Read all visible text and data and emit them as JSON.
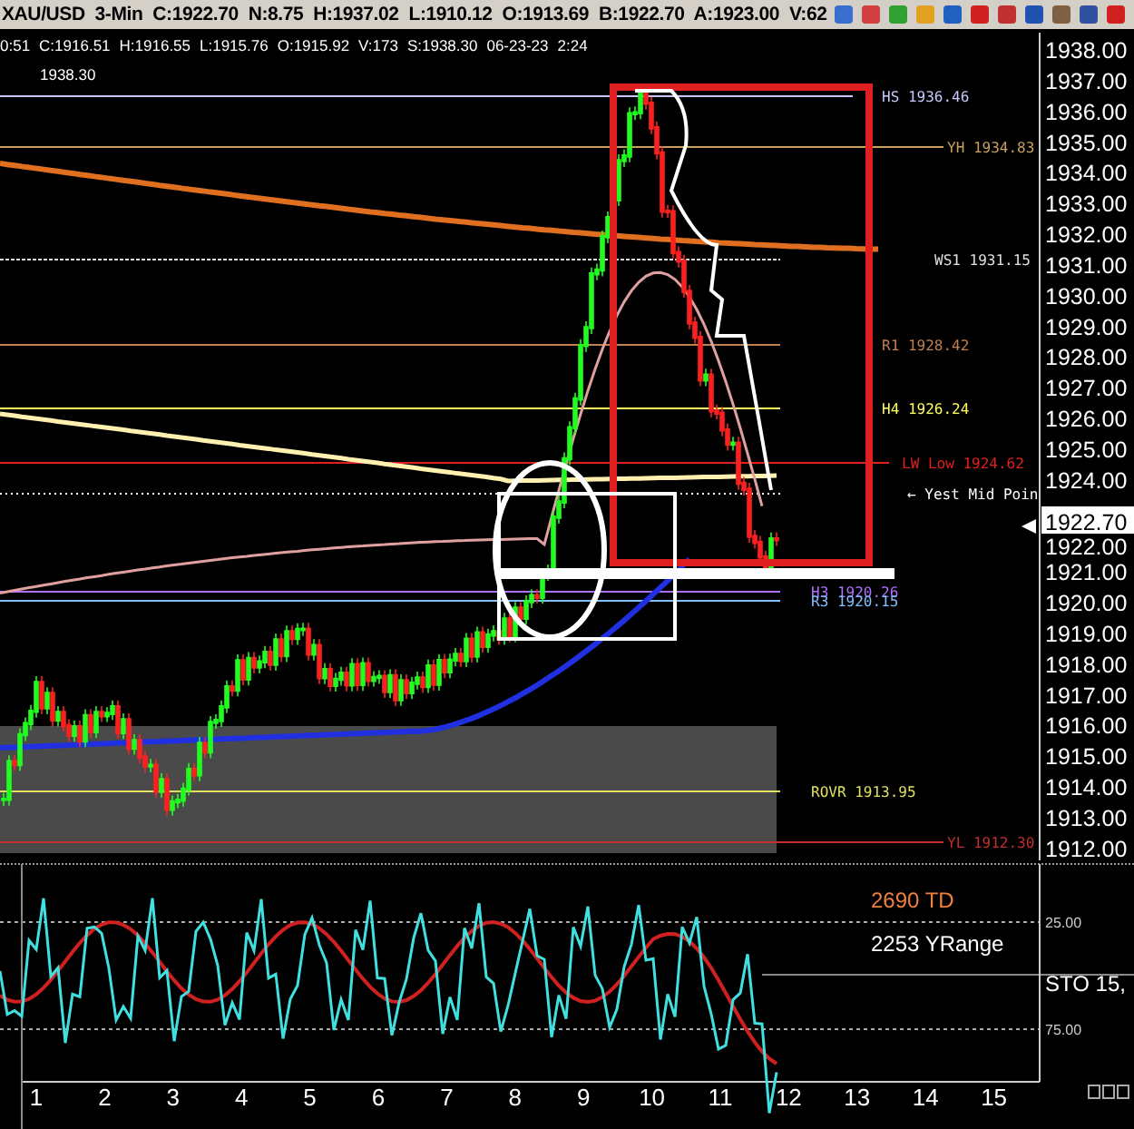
{
  "title_bar": {
    "symbol": "XAU/USD",
    "interval": "3-Min",
    "quote": [
      "C:1922.70",
      "N:8.75",
      "H:1937.02",
      "L:1910.12",
      "O:1913.69",
      "B:1922.70",
      "A:1923.00",
      "V:62"
    ]
  },
  "info_line": [
    "0:51",
    "C:1916.51",
    "H:1916.55",
    "L:1915.76",
    "O:1915.92",
    "V:173",
    "S:1938.30",
    "06-23-23",
    "2:24"
  ],
  "chart": {
    "top_label": "1938.30",
    "price_axis": [
      "1938.00",
      "1937.00",
      "1936.00",
      "1935.00",
      "1934.00",
      "1933.00",
      "1932.00",
      "1931.00",
      "1930.00",
      "1929.00",
      "1928.00",
      "1927.00",
      "1926.00",
      "1925.00",
      "1924.00",
      "1922.00",
      "1921.00",
      "1920.00",
      "1919.00",
      "1918.00",
      "1917.00",
      "1916.00",
      "1915.00",
      "1914.00",
      "1913.00",
      "1912.00"
    ],
    "last_price": "1922.70",
    "levels": [
      {
        "label": "HS 1936.46",
        "color": "#c8c8ff"
      },
      {
        "label": "YH 1934.83",
        "color": "#c8a060"
      },
      {
        "label": "WS1 1931.15",
        "color": "#e0e0e0"
      },
      {
        "label": "R1 1928.42",
        "color": "#c08050"
      },
      {
        "label": "H4 1926.24",
        "color": "#ffff60"
      },
      {
        "label": "LW Low 1924.62",
        "color": "#e02020"
      },
      {
        "label": "← Yest Mid Poin",
        "color": "#ffffff"
      },
      {
        "label": "H3 1920.26",
        "color": "#b070ff"
      },
      {
        "label": "R3 1920.15",
        "color": "#80c0ff"
      },
      {
        "label": "ROVR 1913.95",
        "color": "#e0e060"
      },
      {
        "label": "YL 1912.30",
        "color": "#c03030"
      }
    ]
  },
  "oscillator": {
    "stats": [
      {
        "label": "2690 TD",
        "color": "#f08040"
      },
      {
        "label": "2253 YRange",
        "color": "#ffffff"
      }
    ],
    "scale": [
      "25.00",
      "75.00"
    ],
    "name": "STO  15,"
  },
  "x_axis": [
    "1",
    "2",
    "3",
    "4",
    "5",
    "6",
    "7",
    "8",
    "9",
    "10",
    "11",
    "12",
    "13",
    "14",
    "15"
  ]
}
